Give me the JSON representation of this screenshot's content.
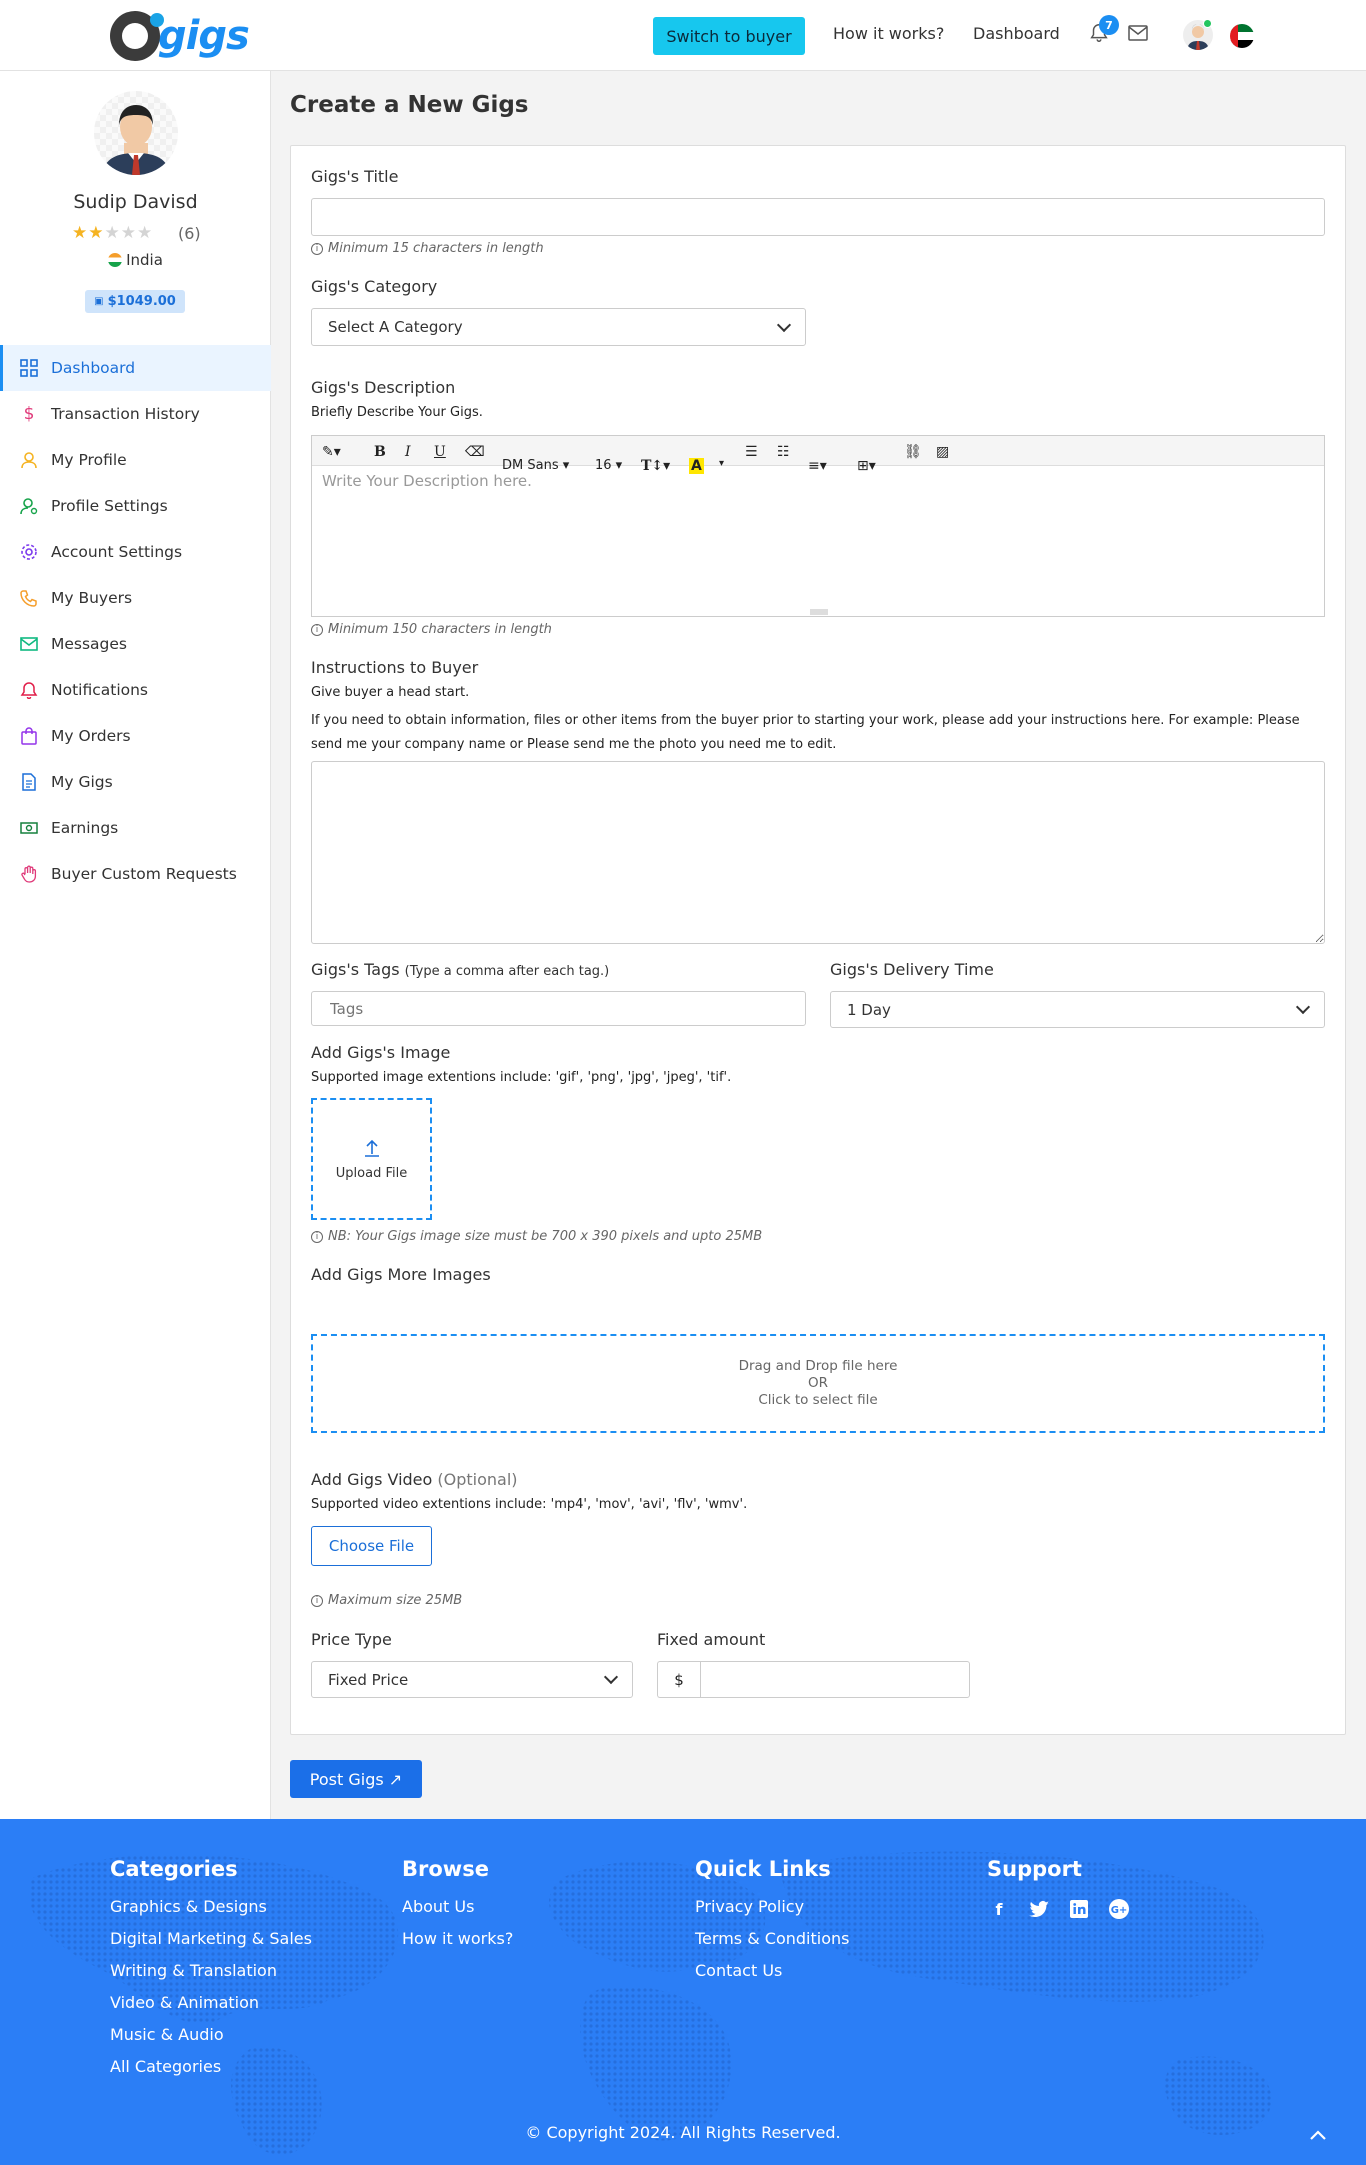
{
  "header": {
    "logo_text": "gigs",
    "switch_label": "Switch to buyer",
    "nav": [
      "How it works?",
      "Dashboard"
    ],
    "notification_count": "7"
  },
  "profile": {
    "name": "Sudip Davisd",
    "rating": 2,
    "rating_max": 5,
    "reviews": "(6)",
    "country": "India",
    "balance": "$1049.00"
  },
  "sidebar": {
    "items": [
      {
        "label": "Dashboard",
        "icon": "dashboard-grid-icon",
        "color": "#1b6fd8"
      },
      {
        "label": "Transaction History",
        "icon": "dollar-icon",
        "color": "#e03a7a"
      },
      {
        "label": "My Profile",
        "icon": "user-icon",
        "color": "#f5b321"
      },
      {
        "label": "Profile Settings",
        "icon": "user-settings-icon",
        "color": "#16a34a"
      },
      {
        "label": "Account Settings",
        "icon": "gear-icon",
        "color": "#7c3aed"
      },
      {
        "label": "My Buyers",
        "icon": "phone-icon",
        "color": "#f59e2b"
      },
      {
        "label": "Messages",
        "icon": "mail-icon",
        "color": "#10b981"
      },
      {
        "label": "Notifications",
        "icon": "bell-icon",
        "color": "#e11d48"
      },
      {
        "label": "My Orders",
        "icon": "bag-icon",
        "color": "#9333ea"
      },
      {
        "label": "My Gigs",
        "icon": "document-icon",
        "color": "#1b6fd8"
      },
      {
        "label": "Earnings",
        "icon": "money-icon",
        "color": "#15803d"
      },
      {
        "label": "Buyer Custom Requests",
        "icon": "hand-icon",
        "color": "#e03a7a"
      }
    ]
  },
  "form": {
    "page_title": "Create a New Gigs",
    "title_label": "Gigs's Title",
    "title_value": "",
    "title_hint": "Minimum 15 characters in length",
    "category_label": "Gigs's Category",
    "category_value": "Select A Category",
    "description_label": "Gigs's Description",
    "description_sub": "Briefly Describe Your Gigs.",
    "description_placeholder": "Write Your Description here.",
    "editor_font": "DM Sans",
    "editor_size": "16",
    "description_hint": "Minimum 150 characters in length",
    "instructions_label": "Instructions to Buyer",
    "instructions_sub1": "Give buyer a head start.",
    "instructions_sub2": "If you need to obtain information, files or other items from the buyer prior to starting your work, please add your instructions here. For example: Please send me your company name or Please send me the photo you need me to edit.",
    "tags_label": "Gigs's Tags",
    "tags_note": "(Type a comma after each tag.)",
    "tags_placeholder": "Tags",
    "delivery_label": "Gigs's Delivery Time",
    "delivery_value": "1 Day",
    "image_label": "Add Gigs's Image",
    "image_sub": "Supported image extentions include: 'gif', 'png', 'jpg', 'jpeg', 'tif'.",
    "upload_label": "Upload File",
    "image_hint": "NB: Your Gigs image size must be 700 x 390 pixels and upto 25MB",
    "more_images_label": "Add Gigs More Images",
    "drop_line1": "Drag and Drop file here",
    "drop_line2": "OR",
    "drop_line3": "Click to select file",
    "video_label": "Add Gigs Video",
    "video_optional": "(Optional)",
    "video_sub": "Supported video extentions include: 'mp4', 'mov', 'avi', 'flv', 'wmv'.",
    "choose_file": "Choose File",
    "video_hint": "Maximum size 25MB",
    "price_type_label": "Price Type",
    "price_type_value": "Fixed Price",
    "fixed_amount_label": "Fixed amount",
    "currency": "$",
    "fixed_amount_value": "",
    "post_button": "Post Gigs ↗"
  },
  "footer": {
    "categories_head": "Categories",
    "categories": [
      "Graphics & Designs",
      "Digital Marketing & Sales",
      "Writing & Translation",
      "Video & Animation",
      "Music & Audio",
      "All Categories"
    ],
    "browse_head": "Browse",
    "browse": [
      "About Us",
      "How it works?"
    ],
    "quick_head": "Quick Links",
    "quick": [
      "Privacy Policy",
      "Terms & Conditions",
      "Contact Us"
    ],
    "support_head": "Support",
    "social": [
      "facebook-icon",
      "twitter-icon",
      "linkedin-icon",
      "google-plus-icon"
    ],
    "copyright": "© Copyright 2024. All Rights Reserved."
  },
  "colors": {
    "primary": "#1b8ef2",
    "switch_button": "#17c7ee",
    "footer_bg": "#2b7ef6"
  }
}
